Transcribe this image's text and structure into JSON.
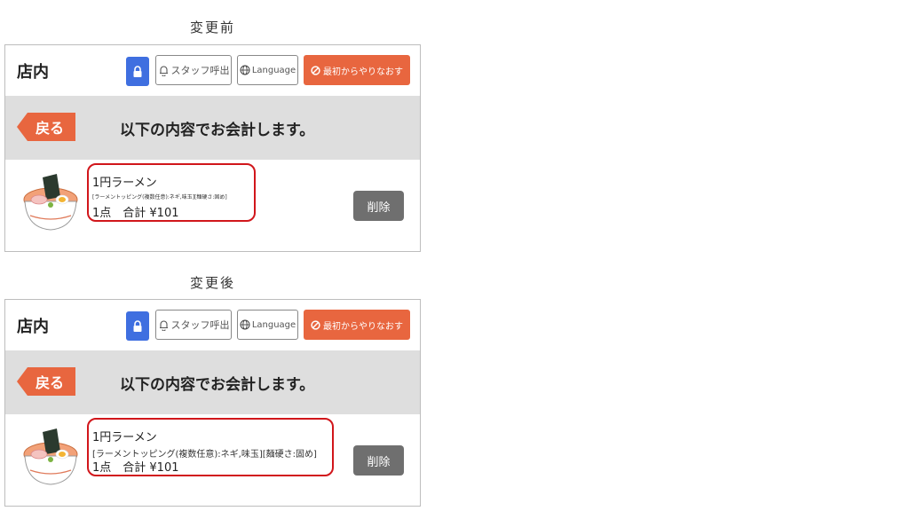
{
  "before": {
    "caption": "変更前",
    "header": {
      "store_name": "店内",
      "staff_call_label": "スタッフ呼出",
      "language_label": "Language",
      "restart_label": "最初からやりなおす"
    },
    "banner": {
      "back_label": "戻る",
      "message": "以下の内容でお会計します。"
    },
    "item": {
      "name": "1円ラーメン",
      "topping": "[ラーメントッピング(複数任意):ネギ,味玉][麺硬さ:固め]",
      "quantity_total": "1点　合計 ¥101",
      "delete_label": "削除"
    }
  },
  "after": {
    "caption": "変更後",
    "header": {
      "store_name": "店内",
      "staff_call_label": "スタッフ呼出",
      "language_label": "Language",
      "restart_label": "最初からやりなおす"
    },
    "banner": {
      "back_label": "戻る",
      "message": "以下の内容でお会計します。"
    },
    "item": {
      "name": "1円ラーメン",
      "topping": "[ラーメントッピング(複数任意):ネギ,味玉][麺硬さ:固め]",
      "quantity_total": "1点　合計 ¥101",
      "delete_label": "削除"
    }
  },
  "colors": {
    "accent_orange": "#e8663f",
    "lock_blue": "#3f6fe0",
    "highlight_red": "#d1161b",
    "banner_gray": "#dedede",
    "delete_gray": "#6f6f6f"
  },
  "icons": [
    "lock-icon",
    "bell-icon",
    "globe-icon",
    "cancel-icon",
    "ramen-bowl-icon"
  ]
}
